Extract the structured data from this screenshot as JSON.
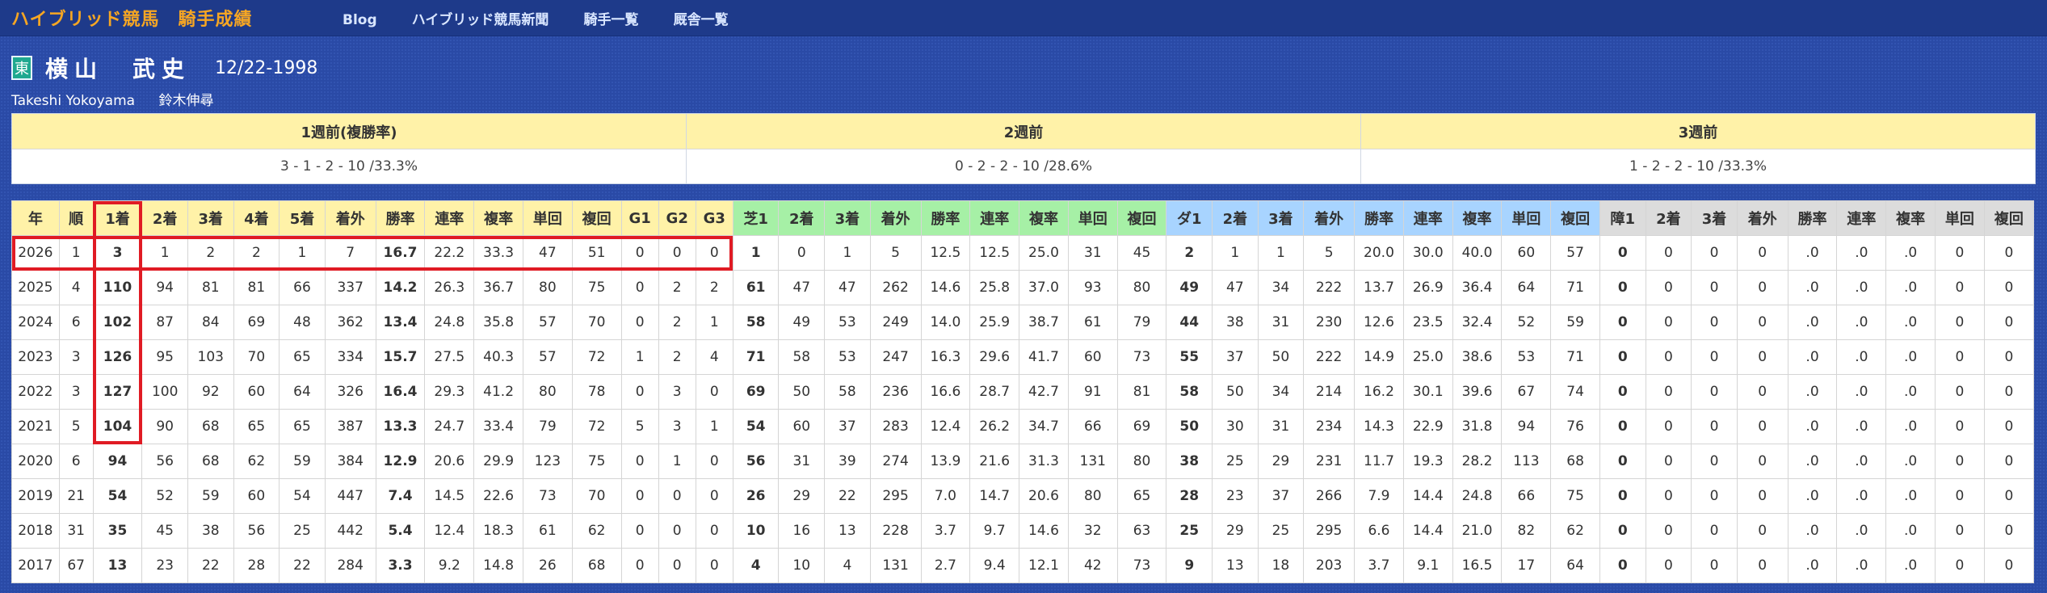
{
  "header": {
    "brand": "ハイブリッド競馬　騎手成績",
    "nav": [
      "Blog",
      "ハイブリッド競馬新聞",
      "騎手一覧",
      "厩舎一覧"
    ]
  },
  "jockey": {
    "stable_badge": "東",
    "name": "横山　武史",
    "birthdate": "12/22-1998",
    "romaji": "Takeshi Yokoyama",
    "trainer_or_agent": "鈴木伸尋"
  },
  "weeks": [
    {
      "label": "1週前(複勝率)",
      "value": "3 - 1 - 2 - 10 /33.3%"
    },
    {
      "label": "2週前",
      "value": "0 - 2 - 2 - 10 /28.6%"
    },
    {
      "label": "3週前",
      "value": "1 - 2 - 2 - 10 /33.3%"
    }
  ],
  "table": {
    "headers": [
      "年",
      "順",
      "1着",
      "2着",
      "3着",
      "4着",
      "5着",
      "着外",
      "勝率",
      "連率",
      "複率",
      "単回",
      "複回",
      "G1",
      "G2",
      "G3",
      "芝1",
      "2着",
      "3着",
      "着外",
      "勝率",
      "連率",
      "複率",
      "単回",
      "複回",
      "ダ1",
      "2着",
      "3着",
      "着外",
      "勝率",
      "連率",
      "複率",
      "単回",
      "複回",
      "障1",
      "2着",
      "3着",
      "着外",
      "勝率",
      "連率",
      "複率",
      "単回",
      "複回"
    ],
    "rows": [
      [
        "2026",
        "1",
        "3",
        "1",
        "2",
        "2",
        "1",
        "7",
        "16.7",
        "22.2",
        "33.3",
        "47",
        "51",
        "0",
        "0",
        "0",
        "1",
        "0",
        "1",
        "5",
        "12.5",
        "12.5",
        "25.0",
        "31",
        "45",
        "2",
        "1",
        "1",
        "5",
        "20.0",
        "30.0",
        "40.0",
        "60",
        "57",
        "0",
        "0",
        "0",
        "0",
        ".0",
        ".0",
        ".0",
        "0",
        "0"
      ],
      [
        "2025",
        "4",
        "110",
        "94",
        "81",
        "81",
        "66",
        "337",
        "14.2",
        "26.3",
        "36.7",
        "80",
        "75",
        "0",
        "2",
        "2",
        "61",
        "47",
        "47",
        "262",
        "14.6",
        "25.8",
        "37.0",
        "93",
        "80",
        "49",
        "47",
        "34",
        "222",
        "13.7",
        "26.9",
        "36.4",
        "64",
        "71",
        "0",
        "0",
        "0",
        "0",
        ".0",
        ".0",
        ".0",
        "0",
        "0"
      ],
      [
        "2024",
        "6",
        "102",
        "87",
        "84",
        "69",
        "48",
        "362",
        "13.4",
        "24.8",
        "35.8",
        "57",
        "70",
        "0",
        "2",
        "1",
        "58",
        "49",
        "53",
        "249",
        "14.0",
        "25.9",
        "38.7",
        "61",
        "79",
        "44",
        "38",
        "31",
        "230",
        "12.6",
        "23.5",
        "32.4",
        "52",
        "59",
        "0",
        "0",
        "0",
        "0",
        ".0",
        ".0",
        ".0",
        "0",
        "0"
      ],
      [
        "2023",
        "3",
        "126",
        "95",
        "103",
        "70",
        "65",
        "334",
        "15.7",
        "27.5",
        "40.3",
        "57",
        "72",
        "1",
        "2",
        "4",
        "71",
        "58",
        "53",
        "247",
        "16.3",
        "29.6",
        "41.7",
        "60",
        "73",
        "55",
        "37",
        "50",
        "222",
        "14.9",
        "25.0",
        "38.6",
        "53",
        "71",
        "0",
        "0",
        "0",
        "0",
        ".0",
        ".0",
        ".0",
        "0",
        "0"
      ],
      [
        "2022",
        "3",
        "127",
        "100",
        "92",
        "60",
        "64",
        "326",
        "16.4",
        "29.3",
        "41.2",
        "80",
        "78",
        "0",
        "3",
        "0",
        "69",
        "50",
        "58",
        "236",
        "16.6",
        "28.7",
        "42.7",
        "91",
        "81",
        "58",
        "50",
        "34",
        "214",
        "16.2",
        "30.1",
        "39.6",
        "67",
        "74",
        "0",
        "0",
        "0",
        "0",
        ".0",
        ".0",
        ".0",
        "0",
        "0"
      ],
      [
        "2021",
        "5",
        "104",
        "90",
        "68",
        "65",
        "65",
        "387",
        "13.3",
        "24.7",
        "33.4",
        "79",
        "72",
        "5",
        "3",
        "1",
        "54",
        "60",
        "37",
        "283",
        "12.4",
        "26.2",
        "34.7",
        "66",
        "69",
        "50",
        "30",
        "31",
        "234",
        "14.3",
        "22.9",
        "31.8",
        "94",
        "76",
        "0",
        "0",
        "0",
        "0",
        ".0",
        ".0",
        ".0",
        "0",
        "0"
      ],
      [
        "2020",
        "6",
        "94",
        "56",
        "68",
        "62",
        "59",
        "384",
        "12.9",
        "20.6",
        "29.9",
        "123",
        "75",
        "0",
        "1",
        "0",
        "56",
        "31",
        "39",
        "274",
        "13.9",
        "21.6",
        "31.3",
        "131",
        "80",
        "38",
        "25",
        "29",
        "231",
        "11.7",
        "19.3",
        "28.2",
        "113",
        "68",
        "0",
        "0",
        "0",
        "0",
        ".0",
        ".0",
        ".0",
        "0",
        "0"
      ],
      [
        "2019",
        "21",
        "54",
        "52",
        "59",
        "60",
        "54",
        "447",
        "7.4",
        "14.5",
        "22.6",
        "73",
        "70",
        "0",
        "0",
        "0",
        "26",
        "29",
        "22",
        "295",
        "7.0",
        "14.7",
        "20.6",
        "80",
        "65",
        "28",
        "23",
        "37",
        "266",
        "7.9",
        "14.4",
        "24.8",
        "66",
        "75",
        "0",
        "0",
        "0",
        "0",
        ".0",
        ".0",
        ".0",
        "0",
        "0"
      ],
      [
        "2018",
        "31",
        "35",
        "45",
        "38",
        "56",
        "25",
        "442",
        "5.4",
        "12.4",
        "18.3",
        "61",
        "62",
        "0",
        "0",
        "0",
        "10",
        "16",
        "13",
        "228",
        "3.7",
        "9.7",
        "14.6",
        "32",
        "63",
        "25",
        "29",
        "25",
        "295",
        "6.6",
        "14.4",
        "21.0",
        "82",
        "62",
        "0",
        "0",
        "0",
        "0",
        ".0",
        ".0",
        ".0",
        "0",
        "0"
      ],
      [
        "2017",
        "67",
        "13",
        "23",
        "22",
        "28",
        "22",
        "284",
        "3.3",
        "9.2",
        "14.8",
        "26",
        "68",
        "0",
        "0",
        "0",
        "4",
        "10",
        "4",
        "131",
        "2.7",
        "9.4",
        "12.1",
        "42",
        "73",
        "9",
        "13",
        "18",
        "203",
        "3.7",
        "9.1",
        "16.5",
        "17",
        "64",
        "0",
        "0",
        "0",
        "0",
        ".0",
        ".0",
        ".0",
        "0",
        "0"
      ]
    ]
  },
  "colors": {
    "background": "#2a4aa6",
    "brand": "#f6a623",
    "header_general": "#fff2a8",
    "header_turf": "#a6f0a6",
    "header_dirt": "#a8d4ff",
    "header_jump": "#dcdcdc",
    "highlight": "#e01b24"
  }
}
